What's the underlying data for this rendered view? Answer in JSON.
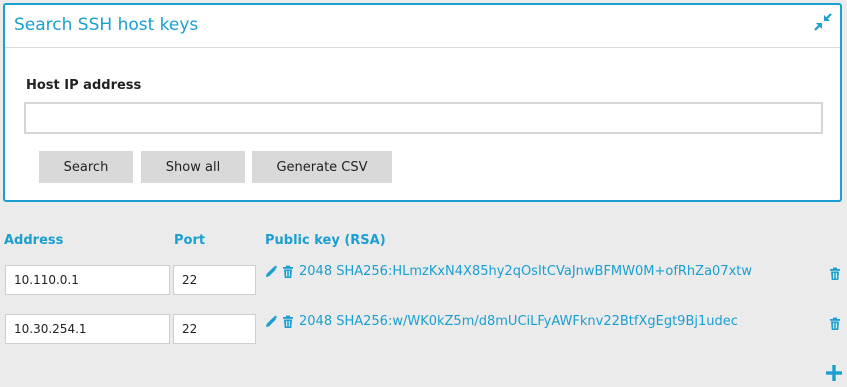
{
  "panel": {
    "title": "Search SSH host keys",
    "collapse_icon": "collapse-arrows-icon",
    "field_label": "Host IP address",
    "ip_value": "",
    "buttons": {
      "search": "Search",
      "show_all": "Show all",
      "generate_csv": "Generate CSV"
    }
  },
  "table": {
    "headers": {
      "address": "Address",
      "port": "Port",
      "public_key": "Public key (RSA)"
    },
    "rows": [
      {
        "address": "10.110.0.1",
        "port": "22",
        "key": "2048 SHA256:HLmzKxN4X85hy2qOsItCVaJnwBFMW0M+ofRhZa07xtw"
      },
      {
        "address": "10.30.254.1",
        "port": "22",
        "key": "2048 SHA256:w/WK0kZ5m/d8mUCiLFyAWFknv22BtfXgEgt9Bj1udec"
      }
    ]
  },
  "colors": {
    "accent": "#1a9fd0",
    "background": "#ebebeb",
    "button": "#d9d9d9"
  },
  "icons": [
    "collapse-arrows-icon",
    "pencil-icon",
    "trash-icon",
    "plus-icon"
  ]
}
